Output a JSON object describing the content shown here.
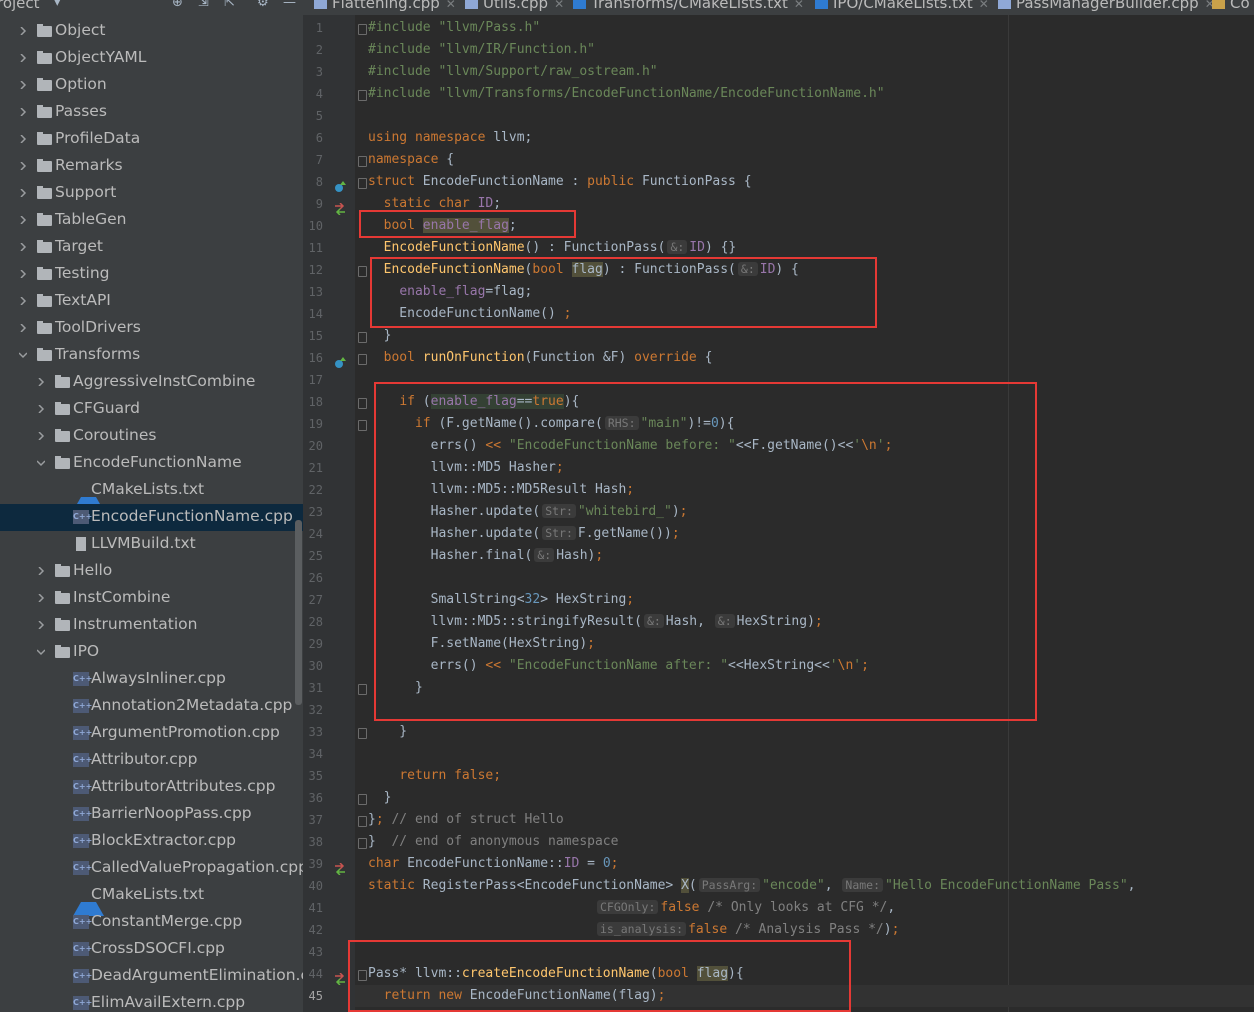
{
  "tree": {
    "header": "roject",
    "items": [
      {
        "label": "Object",
        "kind": "folder",
        "depth": 0,
        "open": false
      },
      {
        "label": "ObjectYAML",
        "kind": "folder",
        "depth": 0,
        "open": false
      },
      {
        "label": "Option",
        "kind": "folder",
        "depth": 0,
        "open": false
      },
      {
        "label": "Passes",
        "kind": "folder",
        "depth": 0,
        "open": false
      },
      {
        "label": "ProfileData",
        "kind": "folder",
        "depth": 0,
        "open": false
      },
      {
        "label": "Remarks",
        "kind": "folder",
        "depth": 0,
        "open": false
      },
      {
        "label": "Support",
        "kind": "folder",
        "depth": 0,
        "open": false
      },
      {
        "label": "TableGen",
        "kind": "folder",
        "depth": 0,
        "open": false
      },
      {
        "label": "Target",
        "kind": "folder",
        "depth": 0,
        "open": false
      },
      {
        "label": "Testing",
        "kind": "folder",
        "depth": 0,
        "open": false
      },
      {
        "label": "TextAPI",
        "kind": "folder",
        "depth": 0,
        "open": false
      },
      {
        "label": "ToolDrivers",
        "kind": "folder",
        "depth": 0,
        "open": false
      },
      {
        "label": "Transforms",
        "kind": "folder",
        "depth": 0,
        "open": true
      },
      {
        "label": "AggressiveInstCombine",
        "kind": "folder",
        "depth": 1,
        "open": false
      },
      {
        "label": "CFGuard",
        "kind": "folder",
        "depth": 1,
        "open": false
      },
      {
        "label": "Coroutines",
        "kind": "folder",
        "depth": 1,
        "open": false
      },
      {
        "label": "EncodeFunctionName",
        "kind": "folder",
        "depth": 1,
        "open": true
      },
      {
        "label": "CMakeLists.txt",
        "kind": "cmake",
        "depth": 2
      },
      {
        "label": "EncodeFunctionName.cpp",
        "kind": "cpp",
        "depth": 2,
        "selected": true
      },
      {
        "label": "LLVMBuild.txt",
        "kind": "txt",
        "depth": 2
      },
      {
        "label": "Hello",
        "kind": "folder",
        "depth": 1,
        "open": false
      },
      {
        "label": "InstCombine",
        "kind": "folder",
        "depth": 1,
        "open": false
      },
      {
        "label": "Instrumentation",
        "kind": "folder",
        "depth": 1,
        "open": false
      },
      {
        "label": "IPO",
        "kind": "folder",
        "depth": 1,
        "open": true
      },
      {
        "label": "AlwaysInliner.cpp",
        "kind": "cpp",
        "depth": 2
      },
      {
        "label": "Annotation2Metadata.cpp",
        "kind": "cpp",
        "depth": 2
      },
      {
        "label": "ArgumentPromotion.cpp",
        "kind": "cpp",
        "depth": 2
      },
      {
        "label": "Attributor.cpp",
        "kind": "cpp",
        "depth": 2
      },
      {
        "label": "AttributorAttributes.cpp",
        "kind": "cpp",
        "depth": 2
      },
      {
        "label": "BarrierNoopPass.cpp",
        "kind": "cpp",
        "depth": 2
      },
      {
        "label": "BlockExtractor.cpp",
        "kind": "cpp",
        "depth": 2
      },
      {
        "label": "CalledValuePropagation.cpp",
        "kind": "cpp",
        "depth": 2
      },
      {
        "label": "CMakeLists.txt",
        "kind": "cmake",
        "depth": 2
      },
      {
        "label": "ConstantMerge.cpp",
        "kind": "cpp",
        "depth": 2
      },
      {
        "label": "CrossDSOCFI.cpp",
        "kind": "cpp",
        "depth": 2
      },
      {
        "label": "DeadArgumentElimination.cpp",
        "kind": "cpp",
        "depth": 2
      },
      {
        "label": "ElimAvailExtern.cpp",
        "kind": "cpp",
        "depth": 2
      }
    ]
  },
  "tabs": [
    {
      "label": "Flattening.cpp",
      "icon": "cpp-file-icon"
    },
    {
      "label": "Utils.cpp",
      "icon": "cpp-file-icon"
    },
    {
      "label": "Transforms/CMakeLists.txt",
      "icon": "cmake-file-icon"
    },
    {
      "label": "IPO/CMakeLists.txt",
      "icon": "cmake-file-icon"
    },
    {
      "label": "PassManagerBuilder.cpp",
      "icon": "cpp-file-icon"
    },
    {
      "label": "Co",
      "icon": "cpp-file-icon"
    }
  ],
  "editor": {
    "current_line": 45,
    "lines": [
      {
        "n": 1,
        "html": "<span class='s'>#include</span> <span class='s'>\"llvm/Pass.h\"</span>"
      },
      {
        "n": 2,
        "html": "<span class='s'>#include</span> <span class='s'>\"llvm/IR/Function.h\"</span>"
      },
      {
        "n": 3,
        "html": "<span class='s'>#include</span> <span class='s'>\"llvm/Support/raw_ostream.h\"</span>"
      },
      {
        "n": 4,
        "html": "<span class='s'>#include</span> <span class='s'>\"llvm/Transforms/EncodeFunctionName/EncodeFunctionName.h\"</span>"
      },
      {
        "n": 5,
        "html": ""
      },
      {
        "n": 6,
        "html": "<span class='k'>using namespace</span> llvm;"
      },
      {
        "n": 7,
        "html": "<span class='k'>namespace</span> {"
      },
      {
        "n": 8,
        "html": "<span class='k'>struct</span> EncodeFunctionName : <span class='k'>public</span> FunctionPass {"
      },
      {
        "n": 9,
        "html": "  <span class='k'>static char</span> <span class='fld'>ID</span>;"
      },
      {
        "n": 10,
        "html": "  <span class='k'>bool</span> <span class='fld hl'>enable_flag</span>;"
      },
      {
        "n": 11,
        "html": "  <span class='f'>EncodeFunctionName</span>() : FunctionPass(<span class='hint'>&amp;:</span><span class='fld'>ID</span>) {}"
      },
      {
        "n": 12,
        "html": "  <span class='f'>EncodeFunctionName</span>(<span class='k'>bool</span> <span class='hl'>flag</span>) : FunctionPass(<span class='hint'>&amp;:</span><span class='fld'>ID</span>) {"
      },
      {
        "n": 13,
        "html": "    <span class='fld'>enable_flag</span>=flag;"
      },
      {
        "n": 14,
        "html": "    EncodeFunctionName() <span class='k'>;</span>"
      },
      {
        "n": 15,
        "html": "  }"
      },
      {
        "n": 16,
        "html": "  <span class='k'>bool</span> <span class='f'>runOnFunction</span>(Function &amp;F) <span class='k'>override</span> {"
      },
      {
        "n": 17,
        "html": ""
      },
      {
        "n": 18,
        "html": "    <span class='k'>if</span> (<span class='fld hl2'>enable_flag</span><span class='hl2'>==</span><span class='k hl2'>true</span>){"
      },
      {
        "n": 19,
        "html": "      <span class='k'>if</span> (F.getName().compare(<span class='hint'>RHS:</span><span class='s'>\"main\"</span>)!=<span class='num'>0</span>){"
      },
      {
        "n": 20,
        "html": "        errs() <span class='k'>&lt;&lt;</span> <span class='s'>\"EncodeFunctionName before: \"</span>&lt;&lt;F.getName()&lt;&lt;<span class='s'>'</span><span class='k'>\\n</span><span class='s'>'</span><span class='k'>;</span>"
      },
      {
        "n": 21,
        "html": "        llvm::MD5 Hasher<span class='k'>;</span>"
      },
      {
        "n": 22,
        "html": "        llvm::MD5::MD5Result Hash<span class='k'>;</span>"
      },
      {
        "n": 23,
        "html": "        Hasher.update(<span class='hint'>Str:</span><span class='s'>\"whitebird_\"</span>)<span class='k'>;</span>"
      },
      {
        "n": 24,
        "html": "        Hasher.update(<span class='hint'>Str:</span>F.getName())<span class='k'>;</span>"
      },
      {
        "n": 25,
        "html": "        Hasher.final(<span class='hint'>&amp;:</span>Hash)<span class='k'>;</span>"
      },
      {
        "n": 26,
        "html": ""
      },
      {
        "n": 27,
        "html": "        SmallString&lt;<span class='num'>32</span>&gt; HexString<span class='k'>;</span>"
      },
      {
        "n": 28,
        "html": "        llvm::MD5::stringifyResult(<span class='hint'>&amp;:</span>Hash, <span class='hint'>&amp;:</span>HexString)<span class='k'>;</span>"
      },
      {
        "n": 29,
        "html": "        F.setName(HexString)<span class='k'>;</span>"
      },
      {
        "n": 30,
        "html": "        errs() <span class='k'>&lt;&lt;</span> <span class='s'>\"EncodeFunctionName after: \"</span>&lt;&lt;HexString&lt;&lt;<span class='s'>'</span><span class='k'>\\n</span><span class='s'>'</span><span class='k'>;</span>"
      },
      {
        "n": 31,
        "html": "      }"
      },
      {
        "n": 32,
        "html": ""
      },
      {
        "n": 33,
        "html": "    }"
      },
      {
        "n": 34,
        "html": ""
      },
      {
        "n": 35,
        "html": "    <span class='k'>return false;</span>"
      },
      {
        "n": 36,
        "html": "  }"
      },
      {
        "n": 37,
        "html": "}<span class='k'>;</span> <span class='c'>// end of struct Hello</span>"
      },
      {
        "n": 38,
        "html": "}  <span class='c'>// end of anonymous namespace</span>"
      },
      {
        "n": 39,
        "html": "<span class='k'>char</span> EncodeFunctionName::<span class='fld'>ID</span> = <span class='num'>0</span><span class='k'>;</span>"
      },
      {
        "n": 40,
        "html": "<span class='k'>static</span> RegisterPass&lt;EncodeFunctionName&gt; <span class='hl'>X</span>(<span class='hint'>PassArg:</span><span class='s'>\"encode\"</span>, <span class='hint'>Name:</span><span class='s'>\"Hello EncodeFunctionName Pass\"</span>,"
      },
      {
        "n": 41,
        "html": "                             <span class='hint'>CFGOnly:</span><span class='k'>false</span> <span class='c'>/* Only looks at CFG */</span>,"
      },
      {
        "n": 42,
        "html": "                             <span class='hint'>is_analysis:</span><span class='k'>false</span> <span class='c'>/* Analysis Pass */</span>)<span class='k'>;</span>"
      },
      {
        "n": 43,
        "html": ""
      },
      {
        "n": 44,
        "html": "Pass* llvm::<span class='f'>createEncodeFunctionName</span>(<span class='k'>bool</span> <span class='hl'>flag</span>){"
      },
      {
        "n": 45,
        "html": "  <span class='k'>return new</span> EncodeFunctionName(flag)<span class='k'>;</span>"
      }
    ]
  },
  "colors": {
    "annotation_box": "#e53935",
    "selection_bg": "#0d293e",
    "editor_bg": "#2b2b2b",
    "tree_bg": "#3c3f41"
  }
}
